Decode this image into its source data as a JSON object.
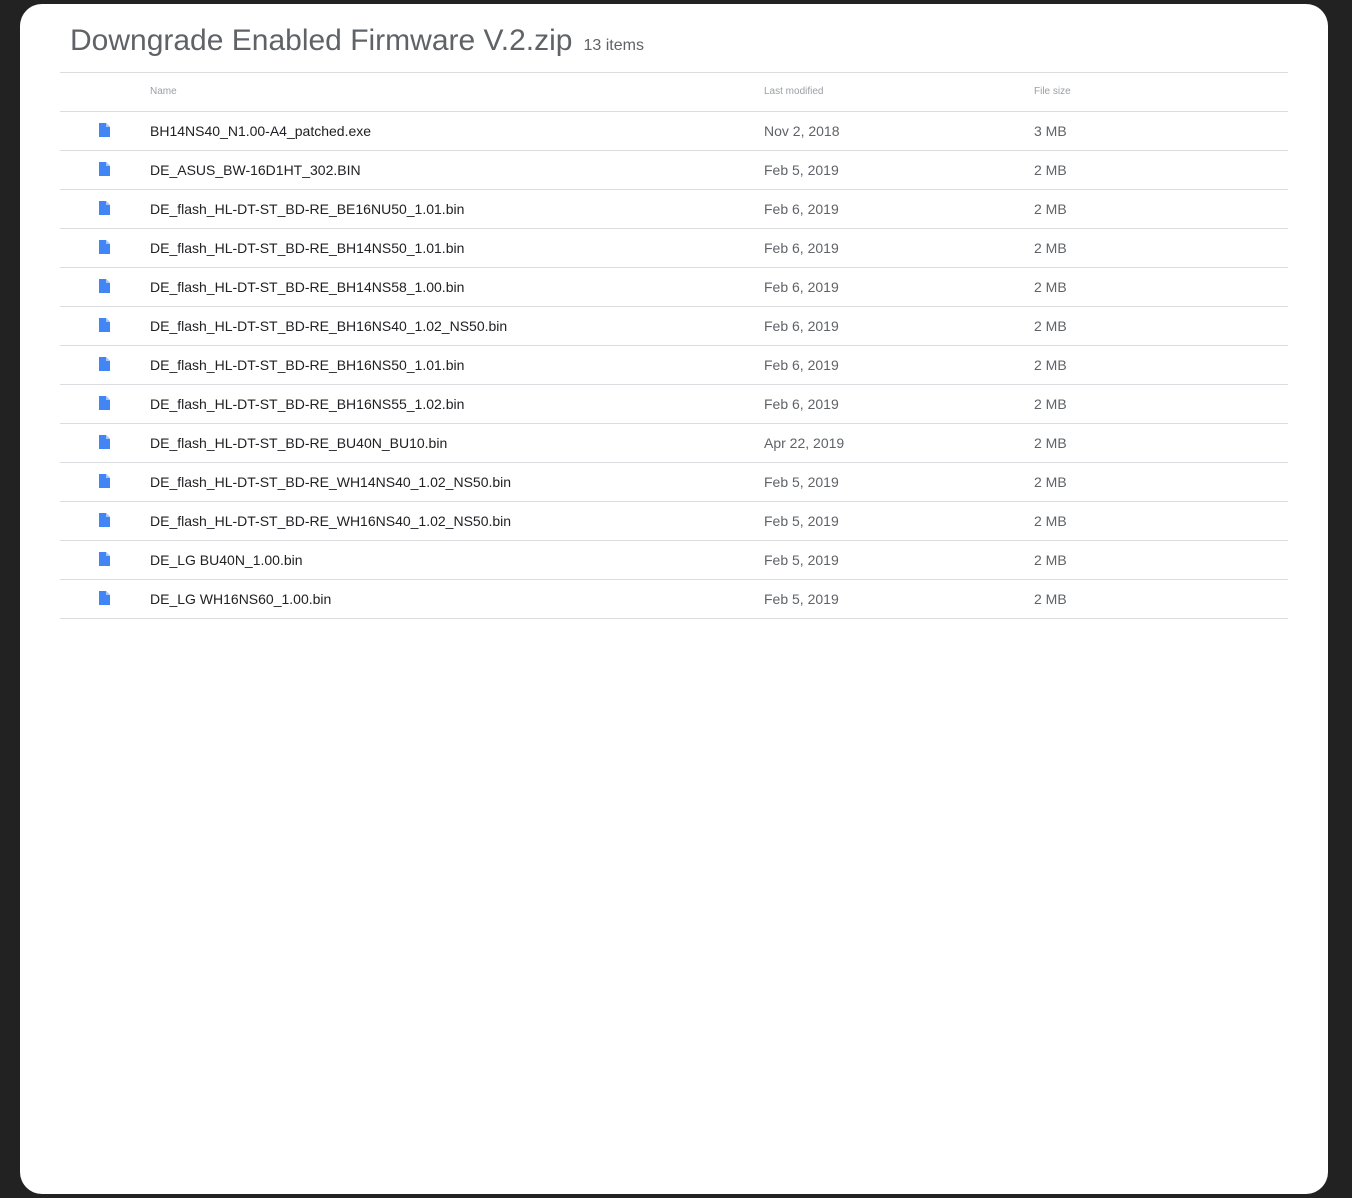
{
  "header": {
    "title": "Downgrade Enabled Firmware V.2.zip",
    "item_count": "13 items"
  },
  "columns": {
    "name": "Name",
    "last_modified": "Last modified",
    "file_size": "File size"
  },
  "icon_color": "#4285f4",
  "files": [
    {
      "icon": "file-icon",
      "name": "BH14NS40_N1.00-A4_patched.exe",
      "modified": "Nov 2, 2018",
      "size": "3 MB"
    },
    {
      "icon": "file-icon",
      "name": "DE_ASUS_BW-16D1HT_302.BIN",
      "modified": "Feb 5, 2019",
      "size": "2 MB"
    },
    {
      "icon": "file-icon",
      "name": "DE_flash_HL-DT-ST_BD-RE_BE16NU50_1.01.bin",
      "modified": "Feb 6, 2019",
      "size": "2 MB"
    },
    {
      "icon": "file-icon",
      "name": "DE_flash_HL-DT-ST_BD-RE_BH14NS50_1.01.bin",
      "modified": "Feb 6, 2019",
      "size": "2 MB"
    },
    {
      "icon": "file-icon",
      "name": "DE_flash_HL-DT-ST_BD-RE_BH14NS58_1.00.bin",
      "modified": "Feb 6, 2019",
      "size": "2 MB"
    },
    {
      "icon": "file-icon",
      "name": "DE_flash_HL-DT-ST_BD-RE_BH16NS40_1.02_NS50.bin",
      "modified": "Feb 6, 2019",
      "size": "2 MB"
    },
    {
      "icon": "file-icon",
      "name": "DE_flash_HL-DT-ST_BD-RE_BH16NS50_1.01.bin",
      "modified": "Feb 6, 2019",
      "size": "2 MB"
    },
    {
      "icon": "file-icon",
      "name": "DE_flash_HL-DT-ST_BD-RE_BH16NS55_1.02.bin",
      "modified": "Feb 6, 2019",
      "size": "2 MB"
    },
    {
      "icon": "file-icon",
      "name": "DE_flash_HL-DT-ST_BD-RE_BU40N_BU10.bin",
      "modified": "Apr 22, 2019",
      "size": "2 MB"
    },
    {
      "icon": "file-icon",
      "name": "DE_flash_HL-DT-ST_BD-RE_WH14NS40_1.02_NS50.bin",
      "modified": "Feb 5, 2019",
      "size": "2 MB"
    },
    {
      "icon": "file-icon",
      "name": "DE_flash_HL-DT-ST_BD-RE_WH16NS40_1.02_NS50.bin",
      "modified": "Feb 5, 2019",
      "size": "2 MB"
    },
    {
      "icon": "file-icon",
      "name": "DE_LG BU40N_1.00.bin",
      "modified": "Feb 5, 2019",
      "size": "2 MB"
    },
    {
      "icon": "file-icon",
      "name": "DE_LG WH16NS60_1.00.bin",
      "modified": "Feb 5, 2019",
      "size": "2 MB"
    }
  ]
}
